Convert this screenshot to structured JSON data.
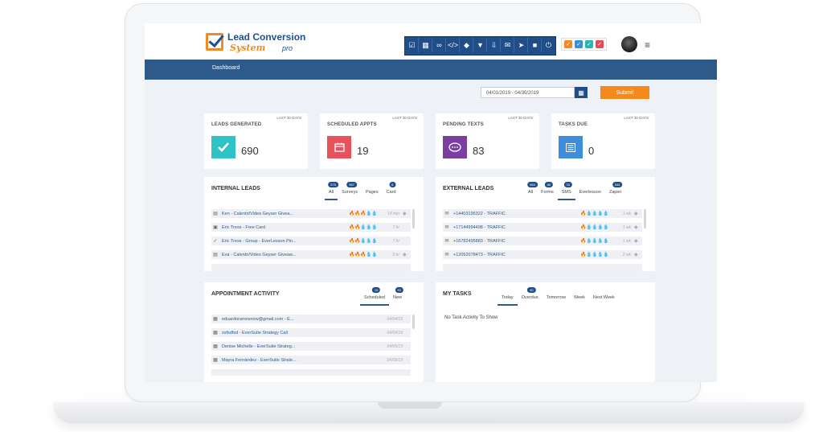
{
  "brand": {
    "line1": "Lead Conversion",
    "line2": "System",
    "line3": "pro",
    "orange": "#f08a24",
    "blue": "#1e4f91"
  },
  "toolbar": {
    "icons": [
      "check-square-icon",
      "calendar-icon",
      "link-icon",
      "code-icon",
      "tag-icon",
      "filter-icon",
      "download-icon",
      "mail-icon",
      "send-icon",
      "lock-icon",
      "power-icon"
    ],
    "color": "#1f4e89"
  },
  "status_squares": [
    {
      "name": "orange-check-icon",
      "color": "#f08a24"
    },
    {
      "name": "blue-check-icon",
      "color": "#3a8fd8"
    },
    {
      "name": "teal-check-icon",
      "color": "#26b6b4"
    },
    {
      "name": "red-check-icon",
      "color": "#e54a5a"
    }
  ],
  "nav": {
    "dashboard": "Dashboard"
  },
  "filter": {
    "date_range": "04/01/2019 - 04/30/2019",
    "submit_label": "Submit"
  },
  "stats": [
    {
      "label": "LEADS GENERATED",
      "period": "LAST 30 DAYS",
      "value": "690",
      "color": "#2ec3c5",
      "icon": "check-icon"
    },
    {
      "label": "SCHEDULED APPTS",
      "period": "LAST 30 DAYS",
      "value": "19",
      "color": "#e8525c",
      "icon": "calendar-icon"
    },
    {
      "label": "PENDING TEXTS",
      "period": "LAST 30 DAYS",
      "value": "83",
      "color": "#7a3fa0",
      "icon": "chat-icon"
    },
    {
      "label": "TASKS DUE",
      "period": "LAST 30 DAYS",
      "value": "0",
      "color": "#3f8edb",
      "icon": "list-icon"
    }
  ],
  "internal_leads": {
    "title": "INTERNAL LEADS",
    "tabs": [
      {
        "label": "All",
        "badge": "575"
      },
      {
        "label": "Surveys",
        "badge": "567"
      },
      {
        "label": "Pages",
        "badge": ""
      },
      {
        "label": "Card",
        "badge": "8"
      }
    ],
    "rows": [
      {
        "name": "Ken - Calentri/Video Geyser Givea...",
        "flames": 3,
        "time": "14 min",
        "tag": true
      },
      {
        "name": "Eric Tress - Free Card",
        "flames": 2,
        "time": "7 hr",
        "tag": false
      },
      {
        "name": "Eric Tress - Group - EverLesson Pin...",
        "flames": 2,
        "time": "7 hr",
        "tag": false
      },
      {
        "name": "Eva - Calentri/Video Geyser Giveaw...",
        "flames": 3,
        "time": "9 hr",
        "tag": true
      }
    ]
  },
  "external_leads": {
    "title": "EXTERNAL LEADS",
    "tabs": [
      {
        "label": "All",
        "badge": "664"
      },
      {
        "label": "Forms",
        "badge": "86"
      },
      {
        "label": "SMS",
        "badge": "33"
      },
      {
        "label": "Everlesson",
        "badge": ""
      },
      {
        "label": "Zapier",
        "badge": "544"
      }
    ],
    "rows": [
      {
        "name": "+14403195322 - TRAFFIC",
        "flames": 1,
        "time": "1 wk"
      },
      {
        "name": "+17144994498 - TRAFFIC",
        "flames": 1,
        "time": "1 wk"
      },
      {
        "name": "+16782495883 - TRAFFIC",
        "flames": 1,
        "time": "1 wk"
      },
      {
        "name": "+12052078473 - TRAFFIC",
        "flames": 1,
        "time": "2 wk"
      }
    ]
  },
  "appointments": {
    "title": "APPOINTMENT ACTIVITY",
    "tabs": [
      {
        "label": "Scheduled",
        "badge": "19"
      },
      {
        "label": "New",
        "badge": "90"
      }
    ],
    "rows": [
      {
        "name": "eduardoramosnow@gmail.com - E...",
        "date": "04/04/19"
      },
      {
        "name": "xsfsdfsd - EverSuite Strategy Call",
        "date": "04/04/19"
      },
      {
        "name": "Denise Michelle - EverSuite Strateg...",
        "date": "04/05/19"
      },
      {
        "name": "Mayra Fernández - EverSuite Strate...",
        "date": "04/09/19"
      }
    ]
  },
  "tasks": {
    "title": "MY TASKS",
    "tabs": [
      {
        "label": "Today",
        "badge": ""
      },
      {
        "label": "Overdue",
        "badge": "45"
      },
      {
        "label": "Tomorrow",
        "badge": ""
      },
      {
        "label": "Week",
        "badge": ""
      },
      {
        "label": "Next Week",
        "badge": ""
      }
    ],
    "empty": "No Task Activity To Show"
  }
}
